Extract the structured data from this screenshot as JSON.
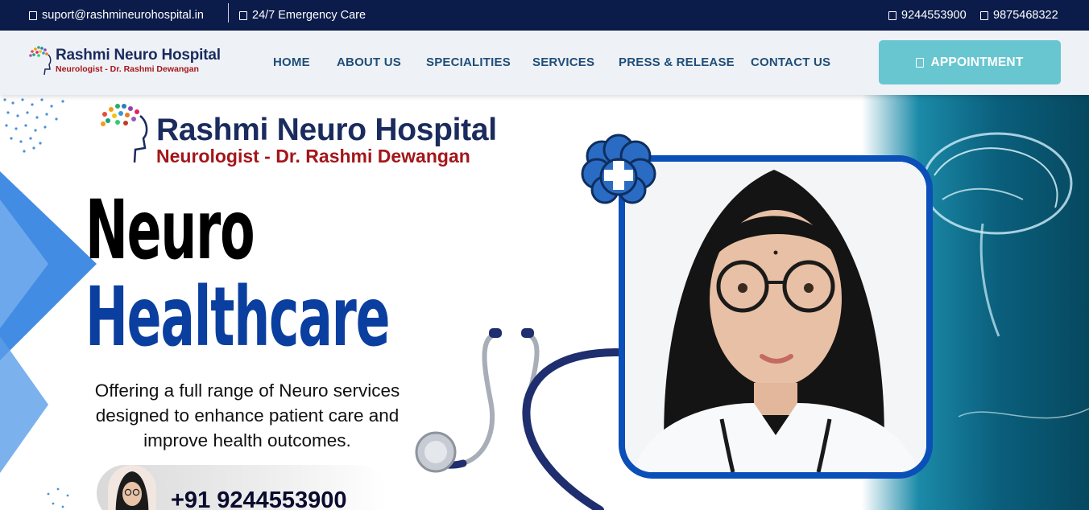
{
  "topbar": {
    "email": "suport@rashmineurohospital.in",
    "emergency": "24/7 Emergency Care",
    "phone1": "9244553900",
    "phone2": "9875468322"
  },
  "navbar": {
    "logo_title": "Rashmi Neuro Hospital",
    "logo_subtitle": "Neurologist - Dr. Rashmi Dewangan",
    "items": [
      "HOME",
      "ABOUT US",
      "SPECIALITIES",
      "SERVICES",
      "PRESS & RELEASE",
      "CONTACT US"
    ],
    "appointment_label": "APPOINTMENT"
  },
  "hero": {
    "logo_title": "Rashmi Neuro Hospital",
    "logo_subtitle": "Neurologist - Dr. Rashmi Dewangan",
    "heading_line1": "Neuro",
    "heading_line2": "Healthcare",
    "description": "Offering a full range of Neuro services designed to enhance patient care and improve health outcomes.",
    "phone": "+91 9244553900"
  },
  "colors": {
    "topbar_bg": "#0b1c4a",
    "nav_text": "#1f4e79",
    "appointment_bg": "#67c6d0",
    "brand_navy": "#1a2b5e",
    "brand_red": "#a4161a",
    "heading_blue": "#0a3fa0",
    "frame_blue": "#0b4fb8"
  }
}
